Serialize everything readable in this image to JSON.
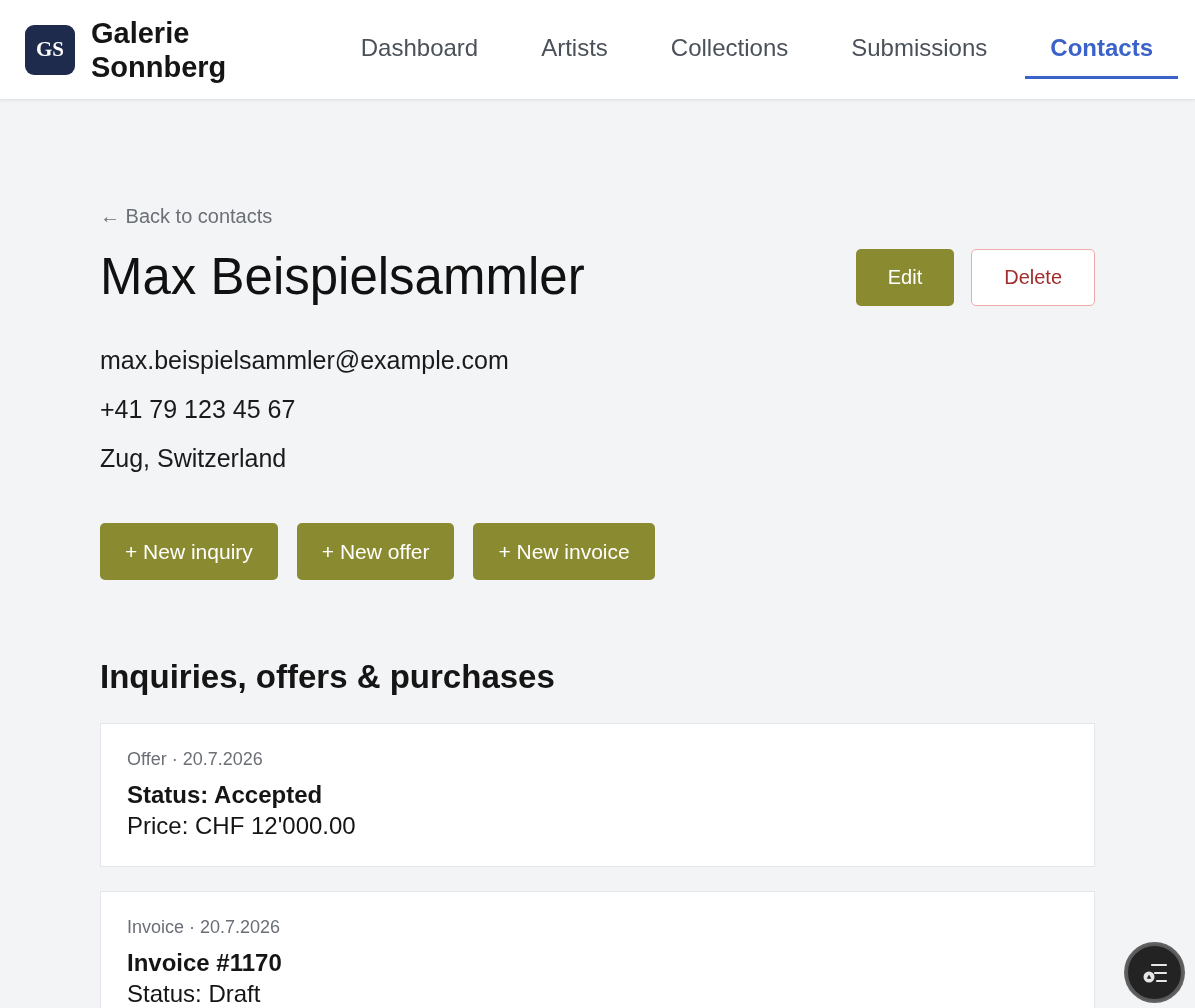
{
  "brand": {
    "logo": "GS",
    "name": "Galerie Sonnberg"
  },
  "nav": [
    {
      "label": "Dashboard",
      "selected": false
    },
    {
      "label": "Artists",
      "selected": false
    },
    {
      "label": "Collections",
      "selected": false
    },
    {
      "label": "Submissions",
      "selected": false
    },
    {
      "label": "Contacts",
      "selected": true
    }
  ],
  "back_link": "← Back to contacts",
  "contact": {
    "name": "Max Beispielsammler",
    "email": "max.beispielsammler@example.com",
    "phone": "+41 79 123 45 67",
    "location": "Zug, Switzerland"
  },
  "actions": [
    {
      "label": "Edit",
      "kind": "primary"
    },
    {
      "label": "Delete",
      "kind": "danger"
    }
  ],
  "create_buttons": [
    "+ New inquiry",
    "+ New offer",
    "+ New invoice"
  ],
  "section_title": "Inquiries, offers & purchases",
  "records": [
    {
      "meta": "Offer · 20.7.2026",
      "title": "Status: Accepted",
      "detail": "Price: CHF 12'000.00"
    },
    {
      "meta": "Invoice · 20.7.2026",
      "title": "Invoice #1170",
      "detail": "Status: Draft"
    }
  ]
}
